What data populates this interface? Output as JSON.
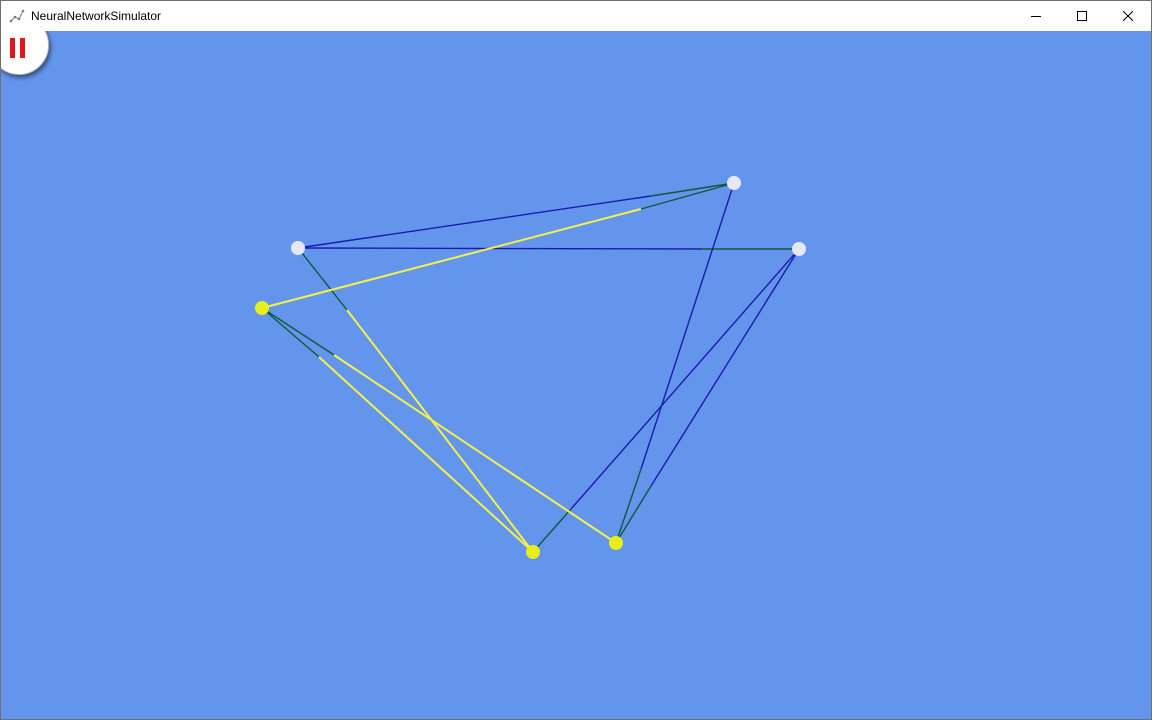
{
  "window": {
    "title": "NeuralNetworkSimulator",
    "icon": "network-graph-icon",
    "controls": {
      "minimize": "minimize-icon",
      "maximize": "maximize-icon",
      "close": "close-icon"
    }
  },
  "simulation": {
    "state": "running",
    "pause_button_icon": "pause-icon",
    "colors": {
      "background": "#6495ED",
      "inactive_neuron": "#E6E8F8",
      "active_neuron": "#E8EE1E",
      "blue_link": "#1A1AAE",
      "green_link": "#0C5A3C",
      "active_link": "#F4F04A",
      "pause_icon": "#E0161B"
    }
  }
}
